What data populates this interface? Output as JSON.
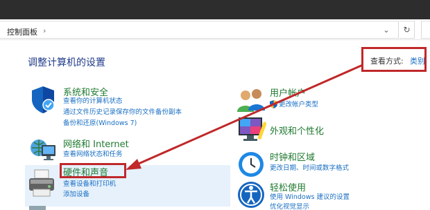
{
  "address": {
    "breadcrumb": "控制面板",
    "chevron": "›",
    "dropdown_glyph": "⌄",
    "refresh_glyph": "↻"
  },
  "page": {
    "title": "调整计算机的设置"
  },
  "view_by": {
    "label": "查看方式:",
    "value": "类别"
  },
  "categories": {
    "system_security": {
      "title": "系统和安全",
      "links": [
        "查看你的计算机状态",
        "通过文件历史记录保存你的文件备份副本",
        "备份和还原(Windows 7)"
      ]
    },
    "network": {
      "title": "网络和 Internet",
      "links": [
        "查看网络状态和任务"
      ]
    },
    "hardware_sound": {
      "title": "硬件和声音",
      "links": [
        "查看设备和打印机",
        "添加设备"
      ]
    },
    "user_accounts": {
      "title": "用户帐户",
      "links": [
        "更改帐户类型"
      ]
    },
    "appearance": {
      "title": "外观和个性化"
    },
    "clock_region": {
      "title": "时钟和区域",
      "links": [
        "更改日期、时间或数字格式"
      ]
    },
    "ease_access": {
      "title": "轻松使用",
      "links": [
        "使用 Windows 建议的设置",
        "优化视觉显示"
      ]
    }
  },
  "colors": {
    "annotation": "#c0282a",
    "link": "#1a6fc4",
    "category_title": "#1f7a30",
    "page_title": "#1e3a8a"
  }
}
